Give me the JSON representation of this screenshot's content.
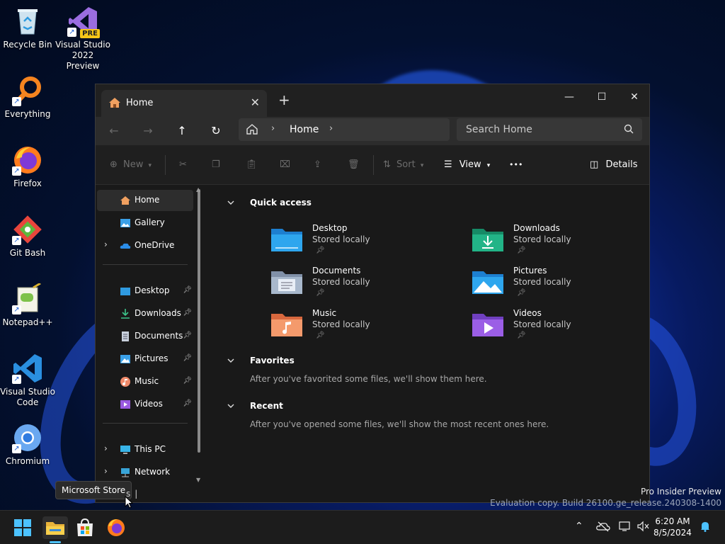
{
  "desktop": {
    "icons": [
      {
        "label": "Recycle Bin"
      },
      {
        "label": "Visual Studio 2022 Preview",
        "badge": "PRE"
      },
      {
        "label": "Everything"
      },
      {
        "label": "Firefox"
      },
      {
        "label": "Git Bash"
      },
      {
        "label": "Notepad++"
      },
      {
        "label": "Visual Studio Code"
      },
      {
        "label": "Chromium"
      }
    ],
    "watermark_line1": "Pro Insider Preview",
    "watermark_line2": "Evaluation copy. Build 26100.ge_release.240308-1400"
  },
  "explorer": {
    "tab_title": "Home",
    "close_tab": "✕",
    "new_tab": "+",
    "window": {
      "minimize": "—",
      "maximize": "☐",
      "close": "✕"
    },
    "address": {
      "crumb": "Home"
    },
    "search_placeholder": "Search Home",
    "toolbar": {
      "new": "New",
      "sort": "Sort",
      "view": "View",
      "more": "•••",
      "details": "Details"
    },
    "sidebar": {
      "home": "Home",
      "gallery": "Gallery",
      "onedrive": "OneDrive",
      "pinned": [
        "Desktop",
        "Downloads",
        "Documents",
        "Pictures",
        "Music",
        "Videos"
      ],
      "this_pc": "This PC",
      "network": "Network"
    },
    "sections": {
      "quick_access": "Quick access",
      "favorites": "Favorites",
      "favorites_msg": "After you've favorited some files, we'll show them here.",
      "recent": "Recent",
      "recent_msg": "After you've opened some files, we'll show the most recent ones here."
    },
    "quick_access": [
      {
        "name": "Desktop",
        "status": "Stored locally"
      },
      {
        "name": "Downloads",
        "status": "Stored locally"
      },
      {
        "name": "Documents",
        "status": "Stored locally"
      },
      {
        "name": "Pictures",
        "status": "Stored locally"
      },
      {
        "name": "Music",
        "status": "Stored locally"
      },
      {
        "name": "Videos",
        "status": "Stored locally"
      }
    ]
  },
  "tooltip": "Microsoft Store",
  "partial_text": "s",
  "taskbar": {
    "time": "6:20 AM",
    "date": "8/5/2024"
  },
  "colors": {
    "accent": "#0078d4",
    "folder_blue": "#1e88e5",
    "folder_green": "#1aa37a",
    "folder_purple": "#8a4fd6",
    "folder_orange": "#ee8a55"
  }
}
